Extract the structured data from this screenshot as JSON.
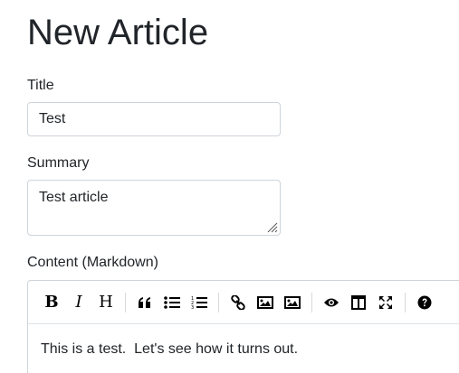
{
  "page": {
    "title": "New Article"
  },
  "form": {
    "title_label": "Title",
    "title_value": "Test",
    "summary_label": "Summary",
    "summary_value": "Test article",
    "content_label": "Content (Markdown)",
    "content_value": "This is a test.  Let's see how it turns out."
  },
  "toolbar": {
    "bold": "B",
    "italic": "I",
    "heading": "H",
    "icons": [
      "bold-icon",
      "italic-icon",
      "heading-icon",
      "quote-icon",
      "unordered-list-icon",
      "ordered-list-icon",
      "link-icon",
      "image-icon",
      "upload-image-icon",
      "preview-icon",
      "side-by-side-icon",
      "fullscreen-icon",
      "help-icon"
    ]
  },
  "colors": {
    "text": "#212529",
    "border": "#ced4da",
    "toolbar_icon": "#000000"
  }
}
